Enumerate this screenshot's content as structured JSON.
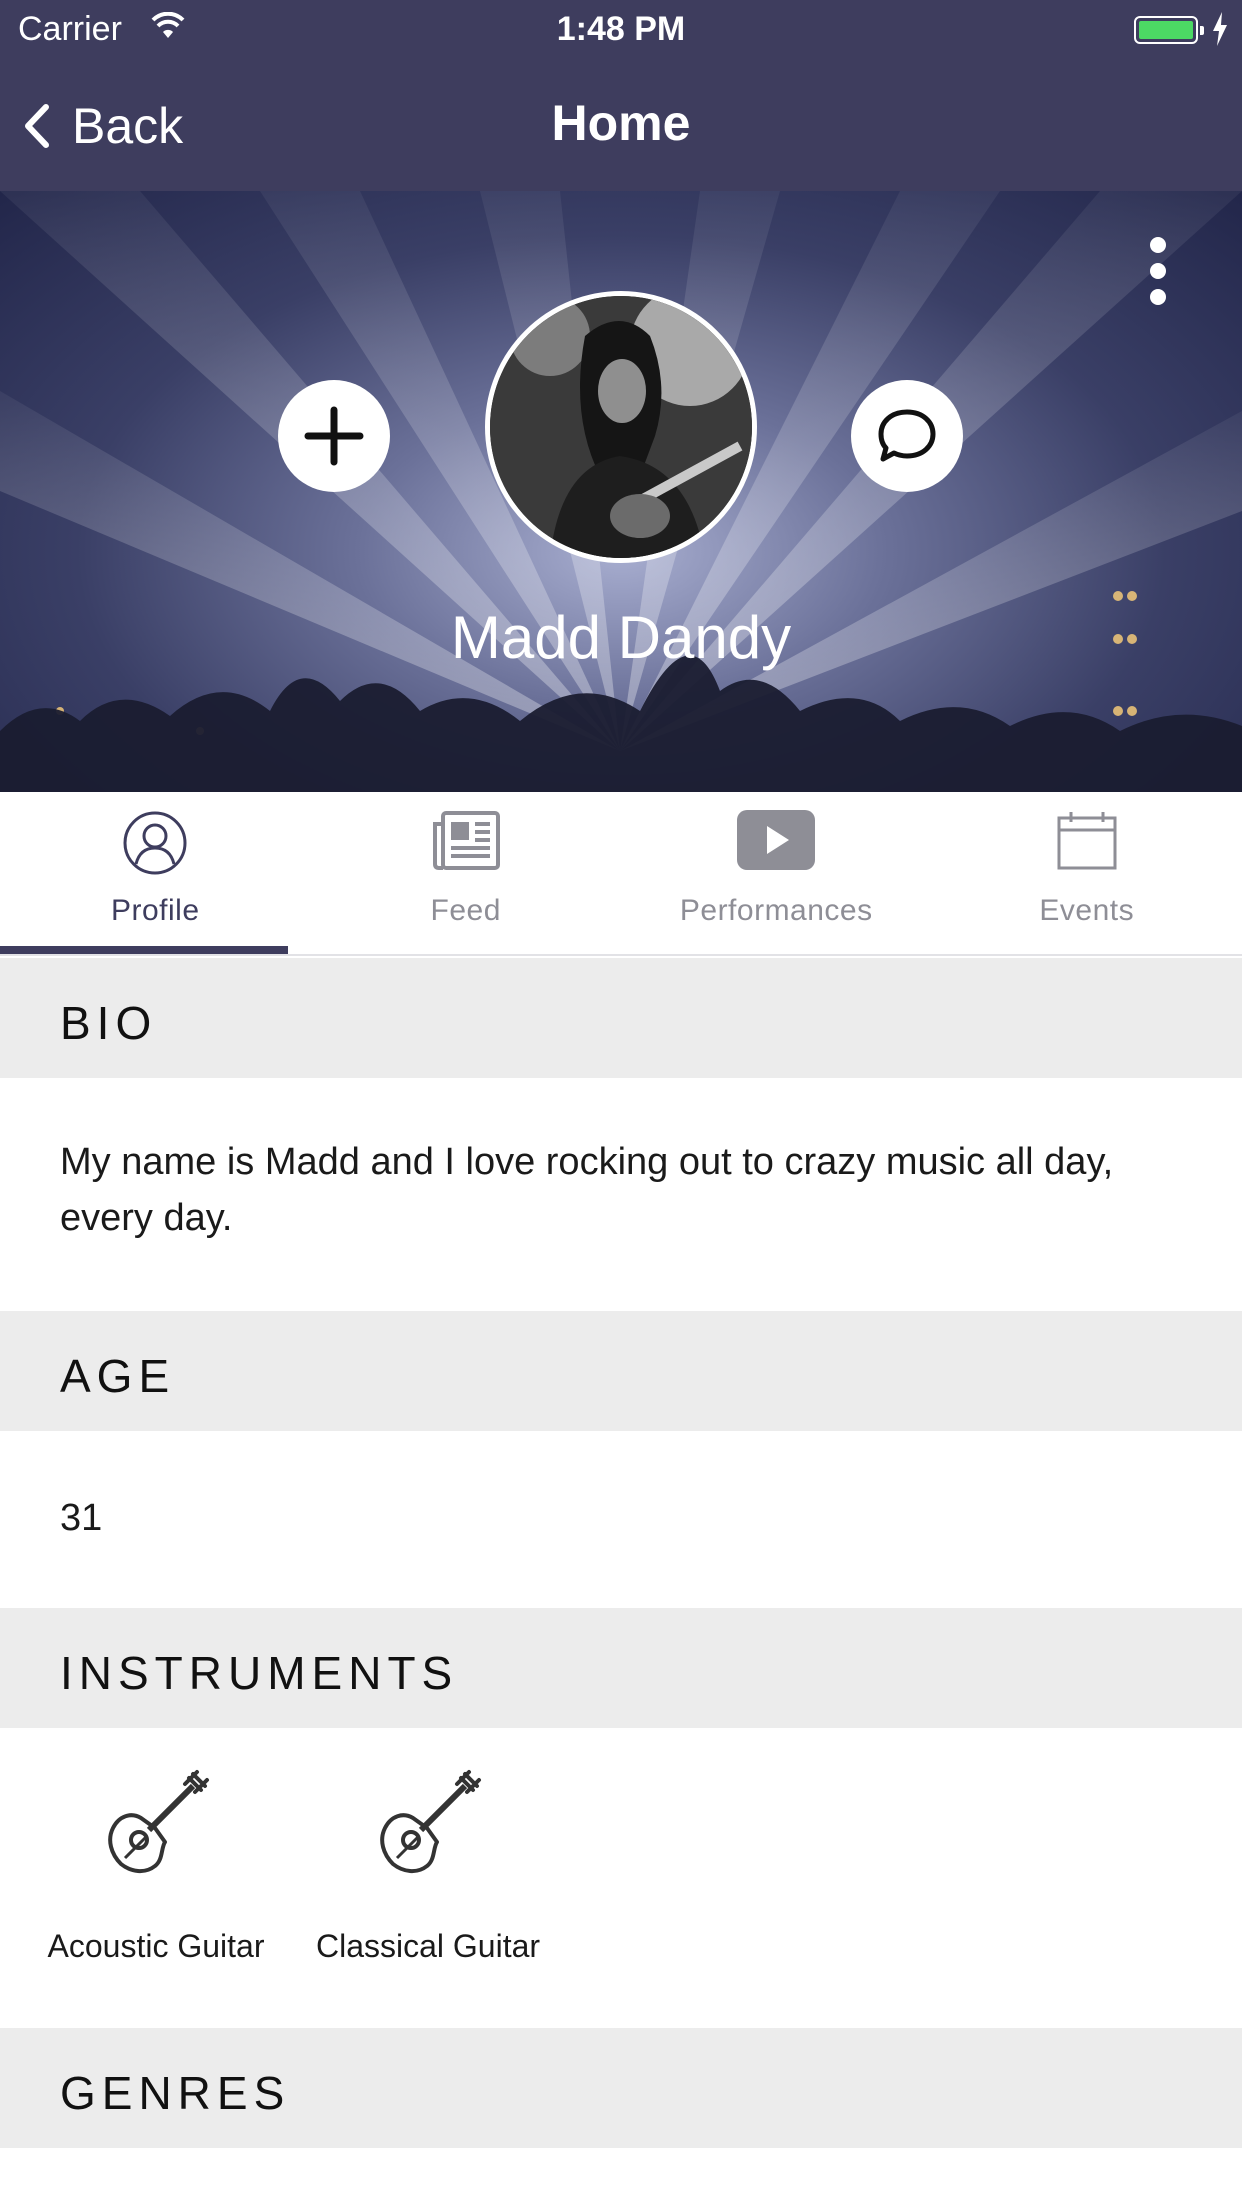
{
  "status_bar": {
    "carrier": "Carrier",
    "time": "1:48 PM",
    "battery_color": "#4cd964"
  },
  "nav": {
    "back_label": "Back",
    "title": "Home",
    "bar_color": "#3e3d5e"
  },
  "profile": {
    "name": "Madd Dandy",
    "add_icon": "plus-icon",
    "message_icon": "chat-bubble-icon",
    "menu_icon": "more-vertical-icon"
  },
  "tabs": [
    {
      "label": "Profile",
      "icon": "person-icon",
      "active": true
    },
    {
      "label": "Feed",
      "icon": "newspaper-icon",
      "active": false
    },
    {
      "label": "Performances",
      "icon": "play-video-icon",
      "active": false
    },
    {
      "label": "Events",
      "icon": "calendar-icon",
      "active": false
    }
  ],
  "sections": {
    "bio": {
      "title": "BIO",
      "text": "My name is Madd and I love rocking out to crazy music all day, every day."
    },
    "age": {
      "title": "AGE",
      "value": "31"
    },
    "instruments": {
      "title": "INSTRUMENTS",
      "items": [
        {
          "label": "Acoustic Guitar",
          "icon": "guitar-icon"
        },
        {
          "label": "Classical Guitar",
          "icon": "guitar-icon"
        }
      ]
    },
    "genres": {
      "title": "GENRES"
    }
  }
}
